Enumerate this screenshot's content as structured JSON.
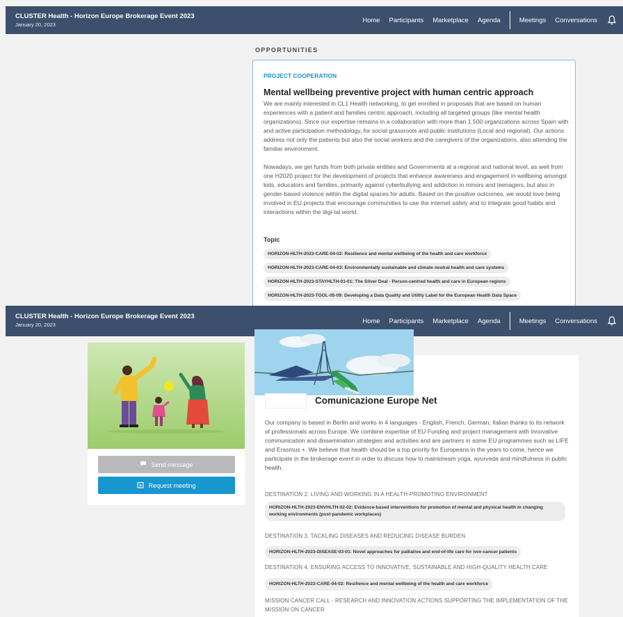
{
  "app": {
    "title": "CLUSTER Health - Horizon Europe Brokerage Event 2023",
    "date": "January 20, 2023"
  },
  "nav": {
    "home": "Home",
    "participants": "Participants",
    "marketplace": "Marketplace",
    "agenda": "Agenda",
    "meetings": "Meetings",
    "conversations": "Conversations",
    "bell_icon": "bell-icon"
  },
  "opportunity": {
    "section_title": "OPPORTUNITIES",
    "type": "PROJECT COOPERATION",
    "title": "Mental wellbeing preventive project with human centric approach",
    "paragraph1": "We are mainly interested in CL1 Health networking, to get enrolled in proposals that are based on human experiences with a patient and families centric approach, including all targeted groups (like mental health organizations). Since our expertise remains in a collaboration with more than 1.500 organizations across Spain with and active participation methodology, for social grassroots and public institutions (Local and regional). Our actions address not only the patients but also the social workers and the caregivers of the organizations, also attending the familiar environment.",
    "paragraph2": "Nowadays, we get funds from both private entities and Governments at a regional and national level, as well from one H2020 project for the development of projects that enhance awareness and engagement in wellbeing amongst kids, educators and families, primarily against cyberbullying and addiction in minors and teenagers, but also in gender-based violence within the digital spaces for adults. Based on the positive outcomes, we would love being involved in EU projects that encourage communities to use the internet safely and to integrate good habits and interactions within the digi-tal world.",
    "topic_label": "Topic",
    "topics": [
      "HORIZON-HLTH-2023-CARE-04-02: Resilience and mental wellbeing of the health and care workforce",
      "HORIZON-HLTH-2023-CARE-04-03: Environmentally sustainable and climate neutral health and care systems",
      "HORIZON-HLTH-2023-STAYHLTH-01-01: The Silver Deal - Person-centred health and care in European regions",
      "HORIZON-HLTH-2023-TOOL-05-09: Developing a Data Quality and Utility Label for the European Health Data Space"
    ]
  },
  "profile": {
    "send_message": "Send message",
    "request_meeting": "Request meeting",
    "company_name": "Comunicazione Europe Net",
    "description": "Our company is based in Berlin and works in 4 languages - English, French, German, Italian thanks to its network of professionals across Europe. We combine expertise of EU Funding and project management with innovative communication and dissemination strategies and activities and are partners in some EU programmes such as LIFE and Erasmus +. We believe that health should be a top priority for Europeans in the years to come, hence we participate in the brokerage event in order to discuss how to mainstream yoga, ayurveda and mindfulness in public health.",
    "destinations": [
      {
        "title": "DESTINATION 2. LIVING AND WORKING IN A HEALTH-PROMOTING ENVIRONMENT",
        "topic": "HORIZON-HLTH-2023-ENVHLTH-02-02: Evidence-based interventions for promotion of mental and physical health in changing working environments (post-pandemic workplaces)"
      },
      {
        "title": "DESTINATION 3. TACKLING DISEASES AND REDUCING DISEASE BURDEN",
        "topic": "HORIZON-HLTH-2023-DISEASE-03-01: Novel approaches for palliative and end-of-life care for non-cancer patients"
      },
      {
        "title": "DESTINATION 4. ENSURING ACCESS TO INNOVATIVE, SUSTAINABLE AND HIGH-QUALITY HEALTH CARE",
        "topic": "HORIZON-HLTH-2023-CARE-04-02: Resilience and mental wellbeing of the health and care workforce"
      },
      {
        "title": "MISSION CANCER CALL - RESEARCH AND INNOVATION ACTIONS SUPPORTING THE IMPLEMENTATION OF THE MISSION ON CANCER"
      }
    ]
  },
  "colors": {
    "navbar": "#3c4f6c",
    "accent": "#1796cf",
    "card_border": "#8ab9d8"
  }
}
